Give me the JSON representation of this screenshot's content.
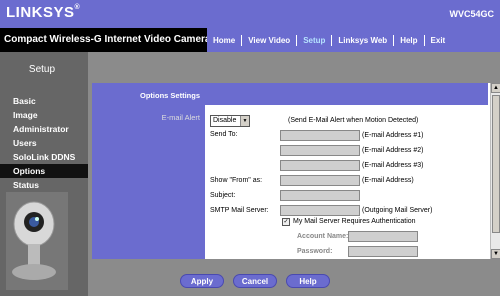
{
  "brand": {
    "logo": "LINKSYS",
    "model": "WVC54GC"
  },
  "header": {
    "product": "Compact Wireless-G Internet Video Camera"
  },
  "nav": {
    "tabs": [
      {
        "label": "Home"
      },
      {
        "label": "View Video"
      },
      {
        "label": "Setup"
      },
      {
        "label": "Linksys Web"
      },
      {
        "label": "Help"
      },
      {
        "label": "Exit"
      }
    ],
    "active": "Setup"
  },
  "sidebar": {
    "title": "Setup",
    "items": [
      {
        "label": "Basic"
      },
      {
        "label": "Image"
      },
      {
        "label": "Administrator"
      },
      {
        "label": "Users"
      },
      {
        "label": "SoloLink DDNS"
      },
      {
        "label": "Options"
      },
      {
        "label": "Status"
      }
    ],
    "active": "Options"
  },
  "panel": {
    "heading": "Options Settings",
    "section_label": "E-mail Alert",
    "alert_select": "Disable",
    "alert_hint": "(Send E-Mail Alert when Motion Detected)",
    "send_to_label": "Send To:",
    "email1_hint": "(E-mail Address #1)",
    "email2_hint": "(E-mail Address #2)",
    "email3_hint": "(E-mail Address #3)",
    "show_from_label": "Show \"From\" as:",
    "show_from_hint": "(E-mail Address)",
    "subject_label": "Subject:",
    "smtp_label": "SMTP Mail Server:",
    "smtp_hint": "(Outgoing Mail Server)",
    "auth_label": "My Mail Server Requires Authentication",
    "account_label": "Account Name:",
    "password_label": "Password:"
  },
  "buttons": {
    "apply": "Apply",
    "cancel": "Cancel",
    "help": "Help"
  },
  "colors": {
    "accent": "#6b6ccf",
    "frame": "#8b8b8b",
    "sidebar": "#666666"
  }
}
